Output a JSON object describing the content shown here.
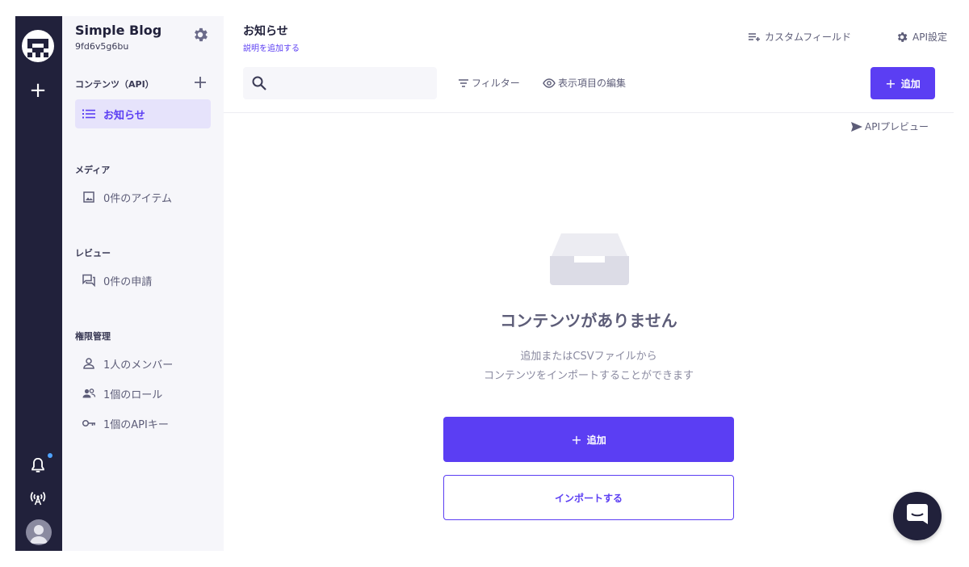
{
  "sidebar": {
    "project_name": "Simple Blog",
    "project_id": "9fd6v5g6bu",
    "contents_section": "コンテンツ（API）",
    "contents_items": [
      {
        "label": "お知らせ",
        "icon": "list-icon",
        "active": true
      }
    ],
    "media_section": "メディア",
    "media_item": "0件のアイテム",
    "review_section": "レビュー",
    "review_item": "0件の申請",
    "permission_section": "権限管理",
    "members_item": "1人のメンバー",
    "roles_item": "1個のロール",
    "apikeys_item": "1個のAPIキー"
  },
  "header": {
    "title": "お知らせ",
    "subtitle": "説明を追加する",
    "custom_field": "カスタムフィールド",
    "api_settings": "API設定"
  },
  "toolbar": {
    "search_placeholder": "",
    "filter": "フィルター",
    "edit_columns": "表示項目の編集",
    "add": "追加",
    "api_preview": "APIプレビュー"
  },
  "empty_state": {
    "title": "コンテンツがありません",
    "desc_line1": "追加またはCSVファイルから",
    "desc_line2": "コンテンツをインポートすることができます",
    "add_button": "追加",
    "import_button": "インポートする"
  },
  "colors": {
    "accent": "#5b3ef3",
    "rail": "#21213b",
    "sidebar_bg": "#f6f6fa",
    "notification_dot": "#4ea3ff"
  }
}
